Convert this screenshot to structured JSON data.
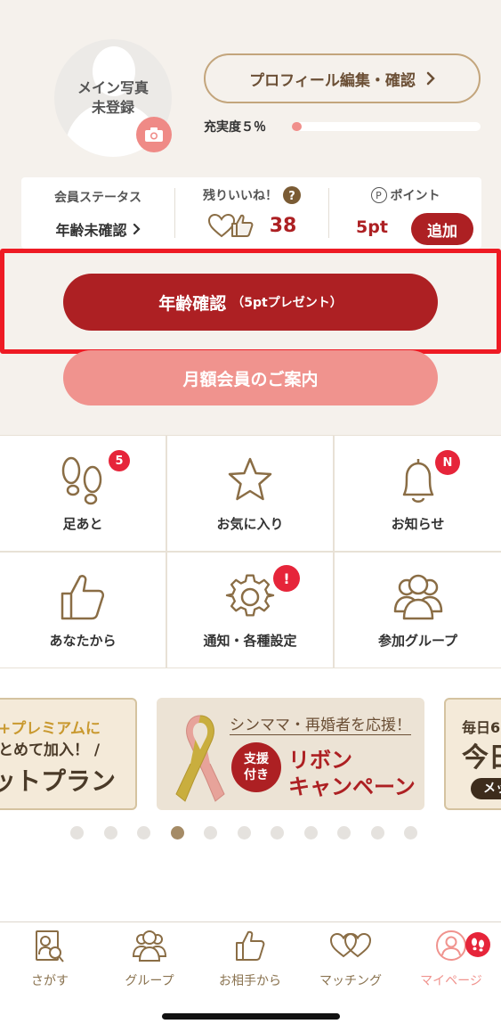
{
  "profile": {
    "photo_text_line1": "メイン写真",
    "photo_text_line2": "未登録",
    "edit_button_label": "プロフィール編集・確認",
    "fill_label": "充実度５％",
    "fill_progress_percent": 5
  },
  "status": {
    "member_status_label": "会員ステータス",
    "member_status_value": "年齢未確認",
    "likes_label": "残りいいね！",
    "likes_count": "38",
    "points_label": "ポイント",
    "points_prefix": "P",
    "points_value": "5pt",
    "add_button_label": "追加"
  },
  "actions": {
    "age_verify_label": "年齢確認",
    "age_verify_sub": "（5ptプレゼント）",
    "monthly_label": "月額会員のご案内"
  },
  "menu": {
    "footprints": {
      "label": "足あと",
      "badge": "5"
    },
    "favorites": {
      "label": "お気に入り"
    },
    "notices": {
      "label": "お知らせ",
      "badge": "N"
    },
    "from_you": {
      "label": "あなたから"
    },
    "settings": {
      "label": "通知・各種設定",
      "badge": "!"
    },
    "groups": {
      "label": "参加グループ"
    }
  },
  "banners": {
    "left_line1": "+プレミアムに",
    "left_line2": "とめて加入！ /",
    "left_line3": "ットプラン",
    "ribbon_top": "シンママ・再婚者を応援！",
    "ribbon_badge_line1": "支援",
    "ribbon_badge_line2": "付き",
    "ribbon_main_line1": "リボン",
    "ribbon_main_line2": "キャンペーン",
    "right_line1": "毎日6",
    "right_line2": "今日",
    "right_line3": "メッ"
  },
  "carousel": {
    "count": 11,
    "active_index": 3
  },
  "tabs": {
    "search": "さがす",
    "group": "グループ",
    "from_partner": "お相手から",
    "matching": "マッチング",
    "mypage": "マイページ"
  },
  "colors": {
    "primary": "#ad2023",
    "pink": "#f0938e",
    "gold": "#a58b66",
    "highlight": "#ee1b24"
  }
}
